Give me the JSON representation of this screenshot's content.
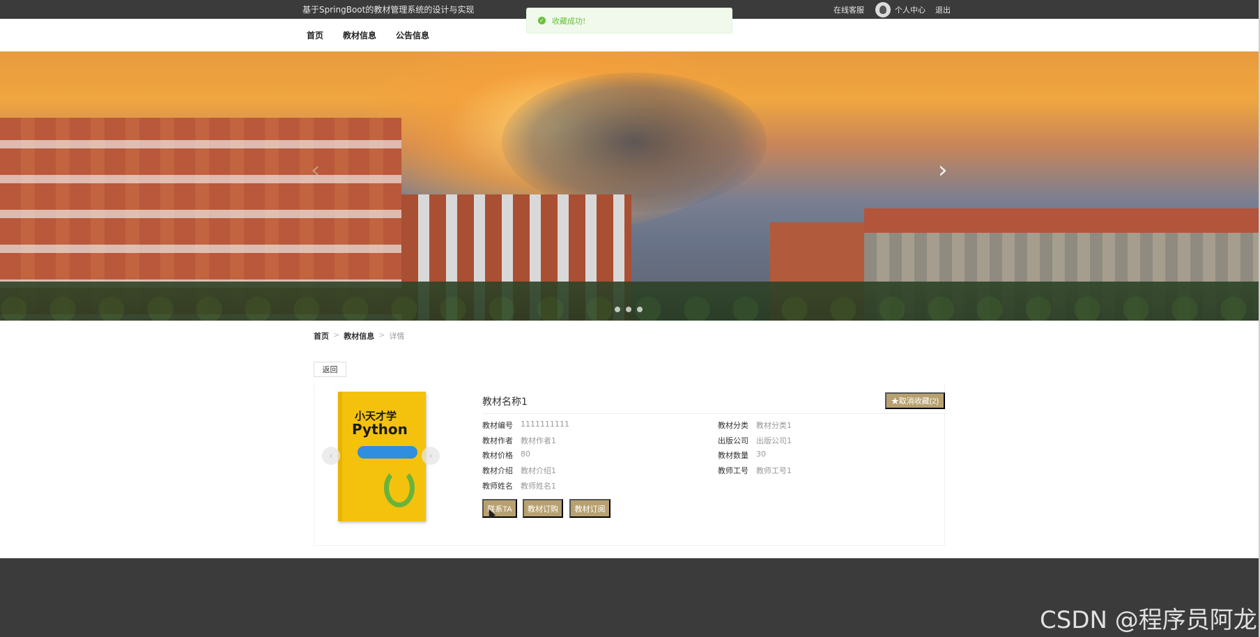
{
  "header": {
    "site_title": "基于SpringBoot的教材管理系统的设计与实现",
    "links": {
      "online_service": "在线客服",
      "personal_center": "个人中心",
      "logout": "退出"
    }
  },
  "toast": {
    "icon": "check-circle-icon",
    "message": "收藏成功!",
    "color": "#67c23a"
  },
  "nav": {
    "items": [
      {
        "label": "首页"
      },
      {
        "label": "教材信息"
      },
      {
        "label": "公告信息"
      }
    ]
  },
  "banner": {
    "slide_count": 3,
    "prev_icon": "chevron-left-icon",
    "next_icon": "chevron-right-icon"
  },
  "breadcrumb": {
    "home": "首页",
    "section": "教材信息",
    "current": "详情",
    "separator": ">"
  },
  "back_label": "返回",
  "detail": {
    "name": "教材名称1",
    "favorite_label": "★取消收藏(2)",
    "cover": {
      "title_line1": "小天才学",
      "title_line2": "Python"
    },
    "fields_left": [
      {
        "key": "教材编号",
        "value": "1111111111"
      },
      {
        "key": "教材作者",
        "value": "教材作者1"
      },
      {
        "key": "教材价格",
        "value": "80"
      },
      {
        "key": "教材介绍",
        "value": "教材介绍1"
      },
      {
        "key": "教师姓名",
        "value": "教师姓名1"
      }
    ],
    "fields_right": [
      {
        "key": "教材分类",
        "value": "教材分类1"
      },
      {
        "key": "出版公司",
        "value": "出版公司1"
      },
      {
        "key": "教材数量",
        "value": "30"
      },
      {
        "key": "教师工号",
        "value": "教师工号1"
      }
    ],
    "actions": {
      "contact": "联系TA",
      "purchase": "教材订购",
      "subscribe": "教材订阅"
    }
  },
  "colors": {
    "accent": "#b8a170",
    "topbar": "#3b3b3b"
  },
  "watermark": "CSDN @程序员阿龙"
}
